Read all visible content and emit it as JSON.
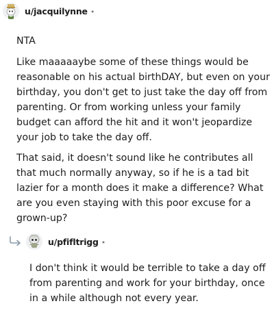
{
  "comments": [
    {
      "username": "u/jacquilynne",
      "separator": "•",
      "paragraphs": [
        "NTA",
        "Like maaaaaybe some of these things would be\nreasonable on his actual birthDAY, but even on your\nbirthday, you don't get to just take the day off from\nparenting. Or from working unless your family\nbudget can afford the hit and it won't jeopardize\nyour job to take the day off.",
        "That said, it doesn't sound like he contributes all\nthat much normally anyway, so if he is a tad bit\nlazier for a month does it make a difference? What\nare you even staying with this poor excuse for a\ngrown-up?"
      ]
    },
    {
      "username": "u/pfifltrigg",
      "separator": "•",
      "paragraphs": [
        "I don't think it would be terrible to take a day off\nfrom parenting and work for your birthday, once\nin a while although not every year."
      ]
    }
  ],
  "icons": {
    "avatar_1": "snoo-avatar-icon",
    "avatar_2": "snoo-avatar-icon",
    "reply": "reply-arrow-icon"
  },
  "colors": {
    "text": "#1c1c1c",
    "muted": "#7c7c7c",
    "background": "#ffffff"
  }
}
